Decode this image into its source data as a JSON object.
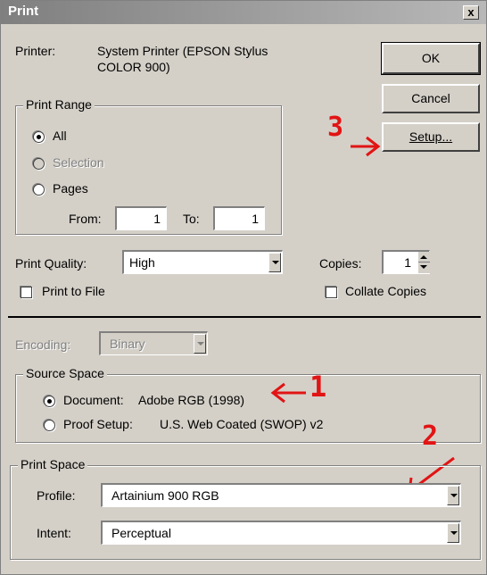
{
  "window": {
    "title": "Print",
    "close_label": "x"
  },
  "printer": {
    "label": "Printer:",
    "name_line1": "System Printer (EPSON Stylus",
    "name_line2": "COLOR 900)"
  },
  "buttons": {
    "ok": "OK",
    "cancel": "Cancel",
    "setup": "Setup..."
  },
  "print_range": {
    "legend": "Print Range",
    "all": "All",
    "selection": "Selection",
    "pages": "Pages",
    "from_label": "From:",
    "from_value": "1",
    "to_label": "To:",
    "to_value": "1"
  },
  "quality": {
    "label": "Print Quality:",
    "value": "High"
  },
  "copies": {
    "label": "Copies:",
    "value": "1"
  },
  "print_to_file": "Print to File",
  "collate": "Collate Copies",
  "encoding": {
    "label": "Encoding:",
    "value": "Binary"
  },
  "source_space": {
    "legend": "Source Space",
    "document_label": "Document:",
    "document_value": "Adobe RGB (1998)",
    "proof_label": "Proof Setup:",
    "proof_value": "U.S. Web Coated (SWOP) v2"
  },
  "print_space": {
    "legend": "Print Space",
    "profile_label": "Profile:",
    "profile_value": "Artainium 900 RGB",
    "intent_label": "Intent:",
    "intent_value": "Perceptual"
  },
  "annotations": {
    "n1": "1",
    "n2": "2",
    "n3": "3"
  },
  "colors": {
    "annotation": "#e21414",
    "dialog_bg": "#d4d0c8",
    "title_bar": "#7f7f7f"
  }
}
